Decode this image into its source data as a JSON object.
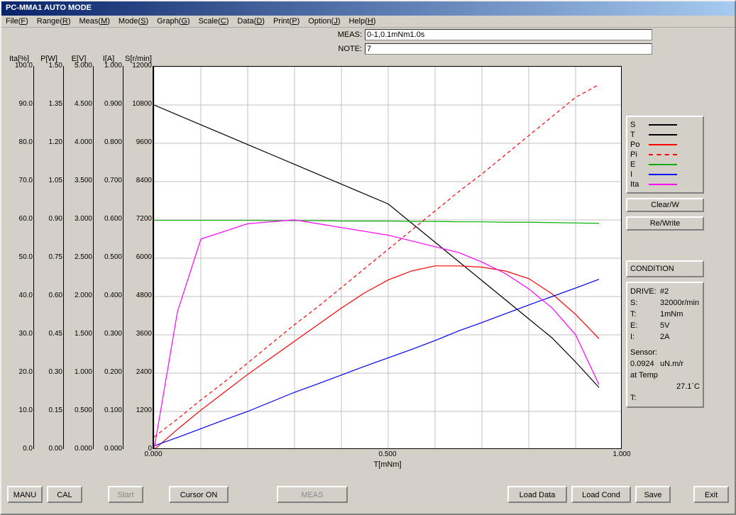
{
  "window": {
    "title": "PC-MMA1 AUTO MODE"
  },
  "menu": {
    "items": [
      {
        "label": "File(F)"
      },
      {
        "label": "Range(R)"
      },
      {
        "label": "Meas(M)"
      },
      {
        "label": "Mode(S)"
      },
      {
        "label": "Graph(G)"
      },
      {
        "label": "Scale(C)"
      },
      {
        "label": "Data(D)"
      },
      {
        "label": "Print(P)"
      },
      {
        "label": "Option(J)"
      },
      {
        "label": "Help(H)"
      }
    ]
  },
  "info": {
    "meas_label": "MEAS:",
    "meas_value": "0-1,0.1mNm1.0s",
    "note_label": "NOTE:",
    "note_value": "7"
  },
  "yaxes": [
    {
      "name": "Ita",
      "label": "Ita[%]",
      "ticks": [
        "100.0",
        "90.0",
        "80.0",
        "70.0",
        "60.0",
        "50.0",
        "40.0",
        "30.0",
        "20.0",
        "10.0",
        "0.0"
      ]
    },
    {
      "name": "P",
      "label": "P[W]",
      "ticks": [
        "1.50",
        "1.35",
        "1.20",
        "1.05",
        "0.90",
        "0.75",
        "0.60",
        "0.45",
        "0.30",
        "0.15",
        "0.00"
      ]
    },
    {
      "name": "E",
      "label": "E[V]",
      "ticks": [
        "5.000",
        "4.500",
        "4.000",
        "3.500",
        "3.000",
        "2.500",
        "2.000",
        "1.500",
        "1.000",
        "0.500",
        "0.000"
      ]
    },
    {
      "name": "I",
      "label": "I[A]",
      "ticks": [
        "1.000",
        "0.900",
        "0.800",
        "0.700",
        "0.600",
        "0.500",
        "0.400",
        "0.300",
        "0.200",
        "0.100",
        "0.000"
      ]
    },
    {
      "name": "S",
      "label": "S[r/min]",
      "ticks": [
        "12000",
        "10800",
        "9600",
        "8400",
        "7200",
        "6000",
        "4800",
        "3600",
        "2400",
        "1200",
        "0"
      ]
    }
  ],
  "xaxis": {
    "label": "T[mNm]",
    "ticks": [
      "0.000",
      "0.500",
      "1.000"
    ]
  },
  "legend": [
    {
      "name": "S",
      "color": "#000000",
      "dash": false
    },
    {
      "name": "T",
      "color": "#000000",
      "dash": false
    },
    {
      "name": "Po",
      "color": "#ff0000",
      "dash": false
    },
    {
      "name": "Pi",
      "color": "#ff0000",
      "dash": true
    },
    {
      "name": "E",
      "color": "#00b000",
      "dash": false
    },
    {
      "name": "I",
      "color": "#0000ff",
      "dash": false
    },
    {
      "name": "Ita",
      "color": "#ff00ff",
      "dash": false
    }
  ],
  "side_buttons": {
    "clear": "Clear/W",
    "rewrite": "Re/Write"
  },
  "condition": {
    "header": "CONDITION",
    "drive_k": "DRIVE:",
    "drive_v": "#2",
    "s_k": "S:",
    "s_v": "32000r/min",
    "t_k": "T:",
    "t_v": "1mNm",
    "e_k": "E:",
    "e_v": "5V",
    "i_k": "I:",
    "i_v": "2A",
    "sensor_k": "Sensor:",
    "sensor_v": "0.0924",
    "sensor_unit": "uN.m/r",
    "temp_k": "at Temp",
    "temp_v": "27.1`C",
    "last_t_k": "T:",
    "last_t_v": ""
  },
  "bottom": {
    "manu": "MANU",
    "cal": "CAL",
    "start": "Start",
    "cursor": "Cursor ON",
    "meas": "MEAS",
    "load_data": "Load Data",
    "load_cond": "Load Cond",
    "save": "Save",
    "exit": "Exit"
  },
  "chart_data": {
    "type": "line",
    "x": [
      0.0,
      0.05,
      0.1,
      0.15,
      0.2,
      0.25,
      0.3,
      0.35,
      0.4,
      0.45,
      0.5,
      0.55,
      0.6,
      0.65,
      0.7,
      0.75,
      0.8,
      0.85,
      0.9,
      0.95
    ],
    "series": [
      {
        "name": "S",
        "axis": "S[r/min]",
        "color": "#000000",
        "dash": false,
        "values": [
          10800,
          10490,
          10180,
          9870,
          9560,
          9250,
          8940,
          8630,
          8320,
          8010,
          7700,
          7100,
          6500,
          5900,
          5300,
          4700,
          4100,
          3500,
          2750,
          1950
        ]
      },
      {
        "name": "Po",
        "axis": "P[W]",
        "color": "#ff0000",
        "dash": false,
        "values": [
          0.0,
          0.08,
          0.155,
          0.225,
          0.295,
          0.36,
          0.425,
          0.49,
          0.555,
          0.615,
          0.665,
          0.7,
          0.72,
          0.72,
          0.715,
          0.7,
          0.67,
          0.61,
          0.53,
          0.435
        ]
      },
      {
        "name": "Pi",
        "axis": "P[W]",
        "color": "#ff0000",
        "dash": true,
        "values": [
          0.05,
          0.12,
          0.195,
          0.265,
          0.34,
          0.415,
          0.49,
          0.56,
          0.635,
          0.71,
          0.785,
          0.86,
          0.935,
          1.01,
          1.08,
          1.155,
          1.23,
          1.305,
          1.38,
          1.43
        ]
      },
      {
        "name": "E",
        "axis": "E[V]",
        "color": "#00b000",
        "dash": false,
        "values": [
          2.995,
          2.995,
          2.995,
          2.995,
          2.995,
          2.99,
          2.99,
          2.99,
          2.985,
          2.985,
          2.985,
          2.98,
          2.98,
          2.975,
          2.975,
          2.97,
          2.97,
          2.965,
          2.96,
          2.955
        ]
      },
      {
        "name": "I",
        "axis": "I[A]",
        "color": "#0000ff",
        "dash": false,
        "values": [
          0.01,
          0.032,
          0.055,
          0.078,
          0.1,
          0.125,
          0.15,
          0.172,
          0.195,
          0.218,
          0.24,
          0.262,
          0.285,
          0.31,
          0.332,
          0.355,
          0.378,
          0.4,
          0.422,
          0.445
        ]
      },
      {
        "name": "Ita",
        "axis": "Ita[%]",
        "color": "#ff00ff",
        "dash": false,
        "values": [
          0.0,
          36.0,
          55.0,
          57.0,
          59.0,
          59.5,
          60.0,
          59.0,
          58.0,
          57.0,
          56.0,
          54.5,
          53.0,
          51.5,
          49.0,
          46.0,
          42.0,
          37.0,
          30.0,
          17.0
        ]
      }
    ],
    "xlabel": "T[mNm]",
    "xlim": [
      0,
      1
    ],
    "ylabels": {
      "S[r/min]": [
        0,
        12000
      ],
      "P[W]": [
        0,
        1.5
      ],
      "E[V]": [
        0,
        5
      ],
      "I[A]": [
        0,
        1
      ],
      "Ita[%]": [
        0,
        100
      ]
    }
  }
}
